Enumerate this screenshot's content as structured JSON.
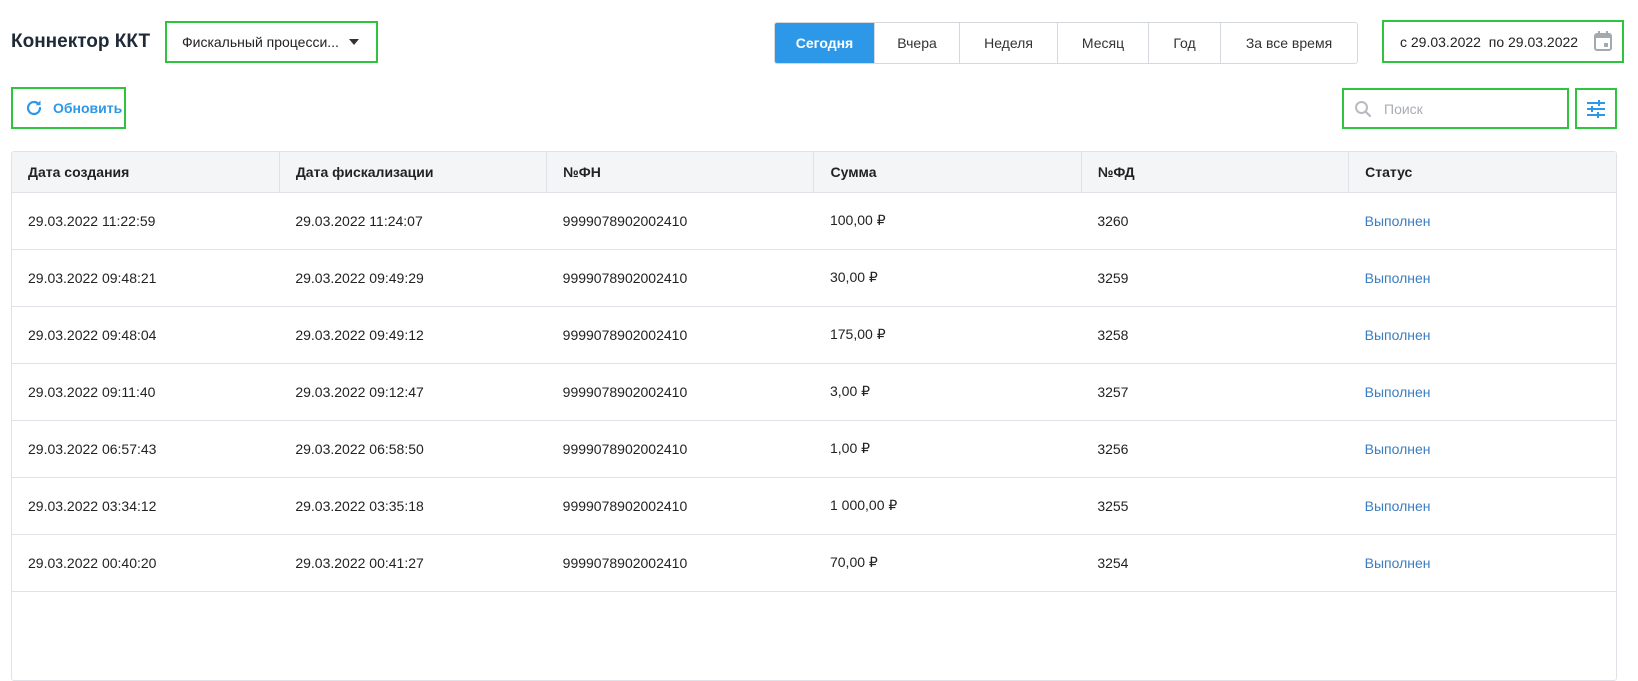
{
  "header": {
    "title": "Коннектор ККТ",
    "processor_select": "Фискальный процесси...",
    "periods": [
      "Сегодня",
      "Вчера",
      "Неделя",
      "Месяц",
      "Год",
      "За все время"
    ],
    "active_period": "Сегодня",
    "date_range": "с 29.03.2022  по 29.03.2022"
  },
  "toolbar": {
    "refresh_label": "Обновить",
    "search_placeholder": "Поиск"
  },
  "colors": {
    "accent": "#2d97e8",
    "highlight": "#2ec43e",
    "status_link": "#3a7dc0"
  },
  "icons": {
    "refresh": "refresh-icon",
    "calendar": "calendar-icon",
    "search": "search-icon",
    "filter": "filter-sliders-icon",
    "dropdown": "caret-down-icon"
  },
  "table": {
    "columns": [
      "Дата создания",
      "Дата фискализации",
      "№ФН",
      "Сумма",
      "№ФД",
      "Статус"
    ],
    "rows": [
      [
        "29.03.2022 11:22:59",
        "29.03.2022 11:24:07",
        "9999078902002410",
        "100,00 ₽",
        "3260",
        "Выполнен"
      ],
      [
        "29.03.2022 09:48:21",
        "29.03.2022 09:49:29",
        "9999078902002410",
        "30,00 ₽",
        "3259",
        "Выполнен"
      ],
      [
        "29.03.2022 09:48:04",
        "29.03.2022 09:49:12",
        "9999078902002410",
        "175,00 ₽",
        "3258",
        "Выполнен"
      ],
      [
        "29.03.2022 09:11:40",
        "29.03.2022 09:12:47",
        "9999078902002410",
        "3,00 ₽",
        "3257",
        "Выполнен"
      ],
      [
        "29.03.2022 06:57:43",
        "29.03.2022 06:58:50",
        "9999078902002410",
        "1,00 ₽",
        "3256",
        "Выполнен"
      ],
      [
        "29.03.2022 03:34:12",
        "29.03.2022 03:35:18",
        "9999078902002410",
        "1 000,00 ₽",
        "3255",
        "Выполнен"
      ],
      [
        "29.03.2022 00:40:20",
        "29.03.2022 00:41:27",
        "9999078902002410",
        "70,00 ₽",
        "3254",
        "Выполнен"
      ]
    ]
  }
}
